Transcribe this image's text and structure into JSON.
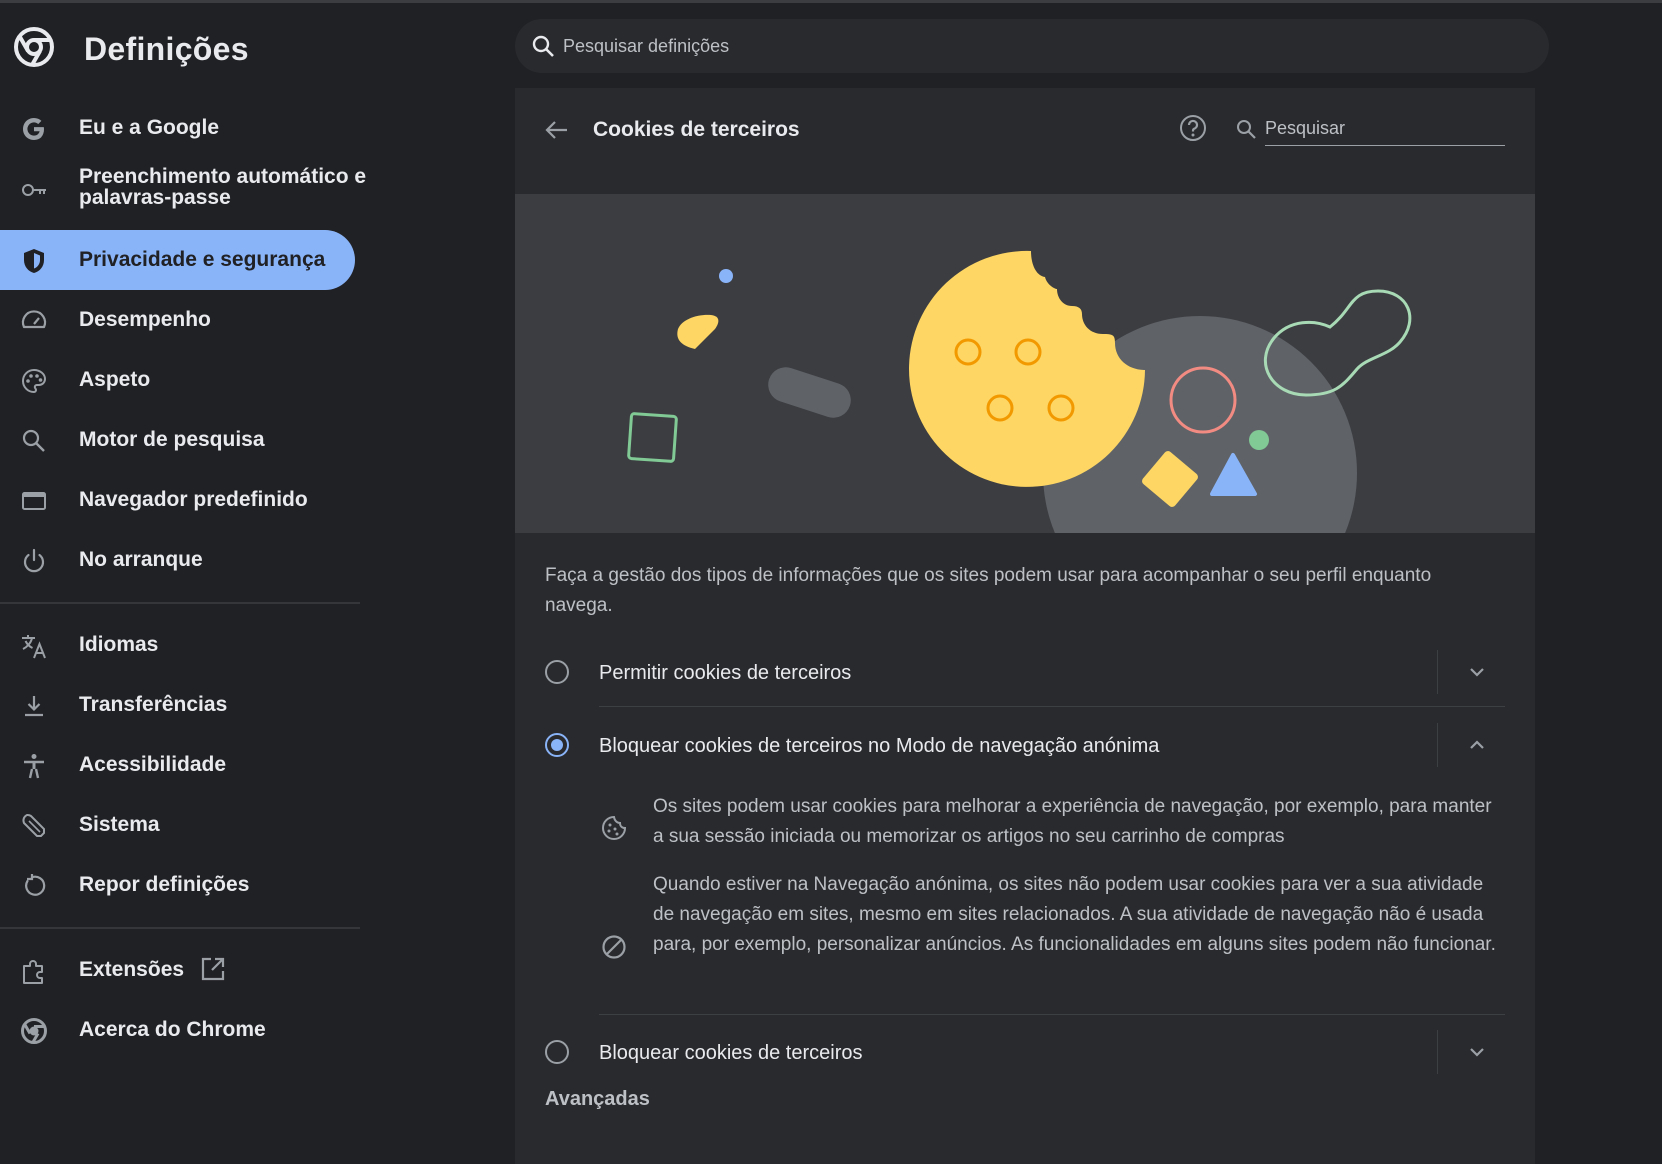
{
  "header": {
    "app_title": "Definições",
    "search_placeholder": "Pesquisar definições"
  },
  "sidebar": {
    "items": [
      {
        "label": "Eu e a Google",
        "icon": "google-g-icon"
      },
      {
        "label": "Preenchimento automático e palavras-passe",
        "icon": "key-icon"
      },
      {
        "label": "Privacidade e segurança",
        "icon": "shield-icon",
        "active": true
      },
      {
        "label": "Desempenho",
        "icon": "speedometer-icon"
      },
      {
        "label": "Aspeto",
        "icon": "palette-icon"
      },
      {
        "label": "Motor de pesquisa",
        "icon": "search-icon"
      },
      {
        "label": "Navegador predefinido",
        "icon": "browser-window-icon"
      },
      {
        "label": "No arranque",
        "icon": "power-icon"
      },
      {
        "label": "Idiomas",
        "icon": "translate-icon"
      },
      {
        "label": "Transferências",
        "icon": "download-icon"
      },
      {
        "label": "Acessibilidade",
        "icon": "accessibility-icon"
      },
      {
        "label": "Sistema",
        "icon": "wrench-icon"
      },
      {
        "label": "Repor definições",
        "icon": "reset-icon"
      },
      {
        "label": "Extensões",
        "icon": "puzzle-icon"
      },
      {
        "label": "Acerca do Chrome",
        "icon": "chrome-icon"
      }
    ]
  },
  "panel": {
    "title": "Cookies de terceiros",
    "search_placeholder": "Pesquisar",
    "description": "Faça a gestão dos tipos de informações que os sites podem usar para acompanhar o seu perfil enquanto navega.",
    "options": [
      {
        "label": "Permitir cookies de terceiros",
        "selected": false,
        "expanded": false
      },
      {
        "label": "Bloquear cookies de terceiros no Modo de navegação anónima",
        "selected": true,
        "expanded": true
      },
      {
        "label": "Bloquear cookies de terceiros",
        "selected": false,
        "expanded": false
      }
    ],
    "details": [
      {
        "icon": "cookie-icon",
        "text": "Os sites podem usar cookies para melhorar a experiência de navegação, por exemplo, para manter a sua sessão iniciada ou memorizar os artigos no seu carrinho de compras"
      },
      {
        "icon": "block-icon",
        "text": "Quando estiver na Navegação anónima, os sites não podem usar cookies para ver a sua atividade de navegação em sites, mesmo em sites relacionados. A sua atividade de navegação não é usada para, por exemplo, personalizar anúncios. As funcionalidades em alguns sites podem não funcionar."
      }
    ],
    "advanced_label": "Avançadas"
  },
  "colors": {
    "background": "#202124",
    "panel": "#292a2d",
    "accent": "#8ab4f8",
    "cookie_yellow": "#fdd663",
    "text_primary": "#e8eaed",
    "text_secondary": "#bdc1c6"
  }
}
